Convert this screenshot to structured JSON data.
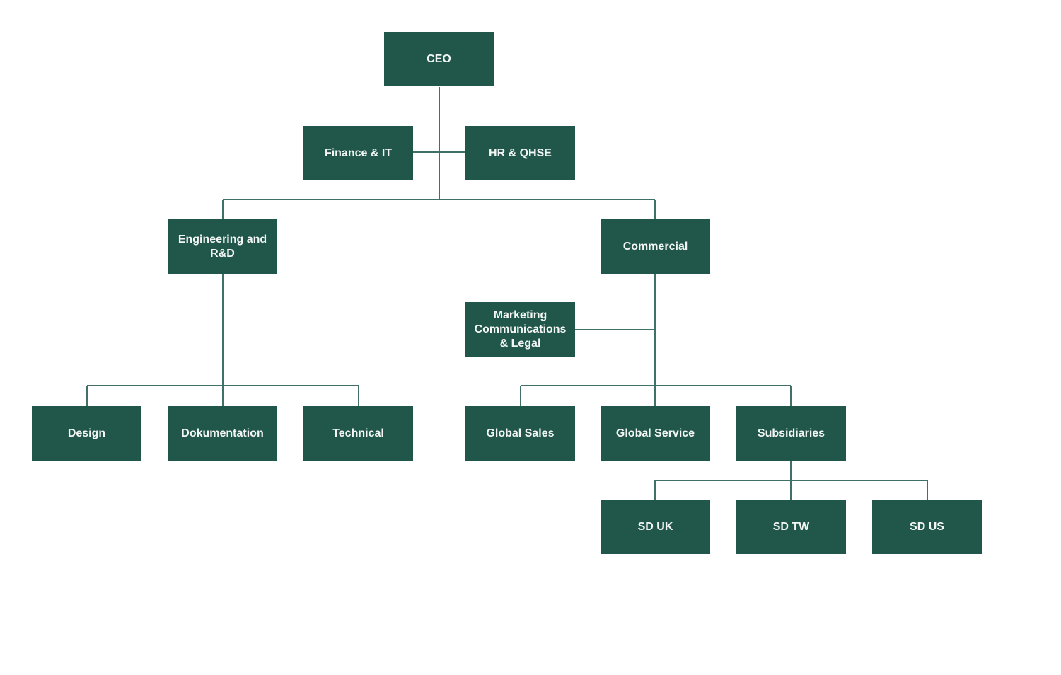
{
  "colors": {
    "box": "#20574a",
    "text": "#f2f5f3",
    "line": "#3f7167",
    "background": "#ffffff"
  },
  "org_chart": {
    "nodes": [
      {
        "id": "ceo",
        "label": "CEO",
        "parent": null
      },
      {
        "id": "finance",
        "label": "Finance & IT",
        "parent": "ceo",
        "role": "staff"
      },
      {
        "id": "hr",
        "label": "HR & QHSE",
        "parent": "ceo",
        "role": "staff"
      },
      {
        "id": "engineering",
        "label": "Engineering and R&D",
        "parent": "ceo"
      },
      {
        "id": "commercial",
        "label": "Commercial",
        "parent": "ceo"
      },
      {
        "id": "marketing",
        "label": "Marketing Communications & Legal",
        "parent": "commercial",
        "role": "staff"
      },
      {
        "id": "design",
        "label": "Design",
        "parent": "engineering"
      },
      {
        "id": "dokumentation",
        "label": "Dokumentation",
        "parent": "engineering"
      },
      {
        "id": "technical",
        "label": "Technical",
        "parent": "engineering"
      },
      {
        "id": "global-sales",
        "label": "Global Sales",
        "parent": "commercial"
      },
      {
        "id": "global-service",
        "label": "Global Service",
        "parent": "commercial"
      },
      {
        "id": "subsidiaries",
        "label": "Subsidiaries",
        "parent": "commercial"
      },
      {
        "id": "sd-uk",
        "label": "SD UK",
        "parent": "subsidiaries"
      },
      {
        "id": "sd-tw",
        "label": "SD TW",
        "parent": "subsidiaries"
      },
      {
        "id": "sd-us",
        "label": "SD US",
        "parent": "subsidiaries"
      }
    ]
  }
}
